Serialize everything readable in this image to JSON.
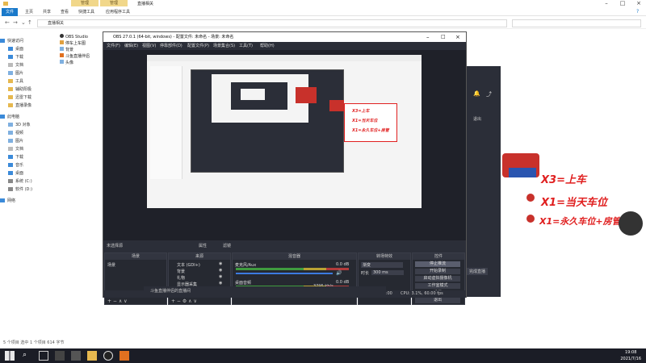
{
  "explorer": {
    "title_ctx_tab1": "管理",
    "title_ctx_tab2": "管理",
    "title_folder": "直播相关",
    "ribbon_tabs": [
      "文件",
      "主页",
      "共享",
      "查看",
      "快捷工具",
      "应用程序工具"
    ],
    "address_path": "直播相关",
    "nav_items": [
      "快速访问",
      "桌面",
      "下载",
      "文档",
      "图片",
      "工具",
      "辅助阳极",
      "迅雷下载",
      "直播录像",
      "此电脑",
      "3D 对象",
      "视频",
      "图片",
      "文档",
      "下载",
      "音乐",
      "桌面",
      "系统 (C:)",
      "软件 (D:)",
      "网络"
    ],
    "files": [
      "OBS Studio",
      "停车上车图",
      "背景",
      "斗鱼直播伴侣",
      "头像"
    ],
    "status": "5 个项目   选中 1 个项目  614 字节"
  },
  "obs": {
    "title": "OBS 27.0.1 (64-bit, windows) - 配置文件: 未命名 - 场景: 未命名",
    "menu": [
      "文件(F)",
      "编辑(E)",
      "视图(V)",
      "停靠部件(D)",
      "配置文件(P)",
      "场景集合(S)",
      "工具(T)",
      "帮助(H)"
    ],
    "scene_bar": {
      "label": "未选择源",
      "props": "属性",
      "filters": "滤镜"
    },
    "docks": {
      "scenes": {
        "title": "场景",
        "items": [
          "场景"
        ]
      },
      "sources": {
        "title": "来源",
        "items": [
          "文本 (GDI+)",
          "背景",
          "礼物",
          "显示器采集"
        ]
      },
      "mixer": {
        "title": "混音器",
        "channels": [
          {
            "name": "麦克风/Aux",
            "db": "0.0 dB"
          },
          {
            "name": "桌面音频",
            "db": "0.0 dB"
          }
        ]
      },
      "transitions": {
        "title": "转场特效",
        "type": "渐变",
        "duration_label": "时长",
        "duration": "300 ms"
      },
      "controls": {
        "title": "控件",
        "buttons": [
          "停止推流",
          "开始录制",
          "启动虚拟摄像机",
          "工作室模式",
          "设置",
          "退出"
        ]
      }
    },
    "status": {
      "live": "LIVE: 00:00:00",
      "rec": "REC: 00:00:00",
      "cpu": "CPU: 3.1%, 60.00 fps",
      "kb": "3795 kb/s"
    },
    "notification": "斗鱼直播伴侣的直播间"
  },
  "bg_app": {
    "button": "退出",
    "button2": "完成直播"
  },
  "overlay": {
    "line1": "X3=上车",
    "line2": "X1=当天车位",
    "line3": "X1=永久车位+房管"
  },
  "taskbar": {
    "time": "19:08",
    "date": "2021/7/16"
  },
  "colors": {
    "ribbon_accent": "#1979ca",
    "obs_bg": "#2b2e38",
    "overlay_red": "#e02020",
    "ctx_tab": "#f1d78a"
  }
}
